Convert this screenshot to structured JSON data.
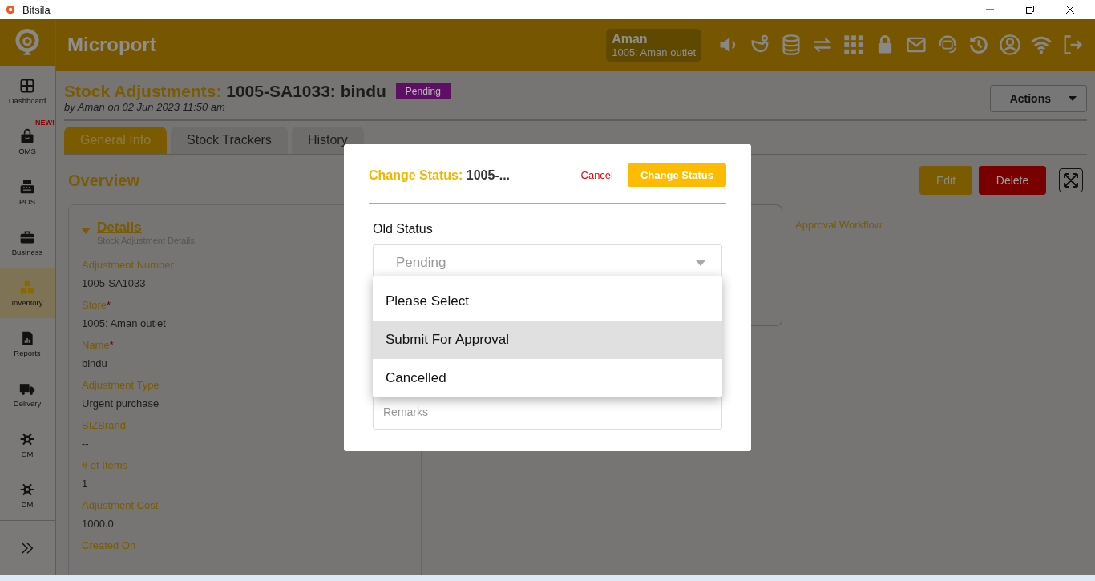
{
  "window": {
    "title": "Bitsila"
  },
  "header": {
    "brand": "Microport",
    "user": {
      "name": "Aman",
      "store": "1005: Aman outlet"
    }
  },
  "sidebar": {
    "items": [
      {
        "label": "Dashboard",
        "selected": false
      },
      {
        "label": "OMS",
        "selected": false,
        "badge": "NEW!"
      },
      {
        "label": "POS",
        "selected": false
      },
      {
        "label": "Business",
        "selected": false
      },
      {
        "label": "Inventory",
        "selected": true
      },
      {
        "label": "Reports",
        "selected": false
      },
      {
        "label": "Delivery",
        "selected": false
      },
      {
        "label": "CM",
        "selected": false
      },
      {
        "label": "DM",
        "selected": false
      }
    ]
  },
  "page": {
    "title_prefix": "Stock Adjustments:",
    "title_value": "1005-SA1033: bindu",
    "status_badge": "Pending",
    "byline": "by Aman on 02 Jun 2023 11:50 am",
    "actions_button": "Actions",
    "tabs": [
      {
        "label": "General Info",
        "selected": true
      },
      {
        "label": "Stock Trackers",
        "selected": false
      },
      {
        "label": "History",
        "selected": false
      }
    ],
    "heading": "Overview",
    "edit_button": "Edit",
    "delete_button": "Delete",
    "details": {
      "title": "Details",
      "subtitle": "Stock Adjustment Details.",
      "expanded": true,
      "fields": [
        {
          "label": "Adjustment Number",
          "value": "1005-SA1033",
          "required": false
        },
        {
          "label": "Store",
          "value": "1005: Aman outlet",
          "required": true
        },
        {
          "label": "Name",
          "value": "bindu",
          "required": true
        },
        {
          "label": "Adjustment Type",
          "value": "Urgent purchase",
          "required": false
        },
        {
          "label": "BIZBrand",
          "value": "--",
          "required": false
        },
        {
          "label": "# of Items",
          "value": "1",
          "required": false
        },
        {
          "label": "Adjustment Cost",
          "value": "1000.0",
          "required": false
        }
      ],
      "required_mark": "*",
      "cut_label": "Created On"
    },
    "approval_link": "Approval Workflow"
  },
  "modal": {
    "title_prefix": "Change Status:",
    "title_value": "1005-...",
    "cancel": "Cancel",
    "submit": "Change Status",
    "old_status_label": "Old Status",
    "old_status_value": "Pending",
    "options": [
      {
        "label": "Please Select",
        "selected": false
      },
      {
        "label": "Submit For Approval",
        "selected": true
      },
      {
        "label": "Cancelled",
        "selected": false
      }
    ],
    "remarks_placeholder": "Remarks"
  }
}
